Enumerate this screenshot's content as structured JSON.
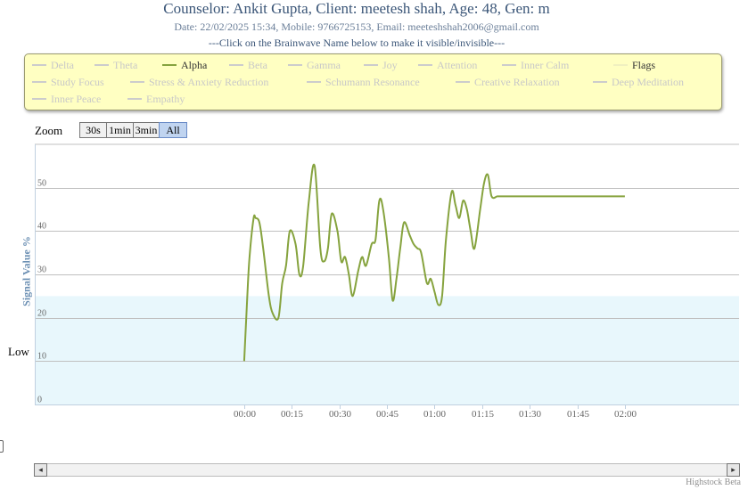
{
  "header": {
    "title": "Counselor: Ankit Gupta, Client: meetesh shah, Age: 48, Gen: m",
    "subtitle": "Date: 22/02/2025 15:34, Mobile: 9766725153, Email: meeteshshah2006@gmail.com",
    "instruction": "---Click on the Brainwave Name below to make it visible/invisible---"
  },
  "legend": {
    "items": [
      {
        "label": "Delta",
        "visible": false
      },
      {
        "label": "Theta",
        "visible": false
      },
      {
        "label": "Alpha",
        "visible": true
      },
      {
        "label": "Beta",
        "visible": false
      },
      {
        "label": "Gamma",
        "visible": false
      },
      {
        "label": "Joy",
        "visible": false
      },
      {
        "label": "Attention",
        "visible": false
      },
      {
        "label": "Inner Calm",
        "visible": false
      },
      {
        "label": "Flags",
        "visible": true
      },
      {
        "label": "Study Focus",
        "visible": false
      },
      {
        "label": "Stress & Anxiety Reduction",
        "visible": false
      },
      {
        "label": "Schumann Resonance",
        "visible": false
      },
      {
        "label": "Creative Relaxation",
        "visible": false
      },
      {
        "label": "Deep Meditation",
        "visible": false
      },
      {
        "label": "Inner Peace",
        "visible": false
      },
      {
        "label": "Empathy",
        "visible": false
      }
    ]
  },
  "zoom": {
    "label": "Zoom",
    "buttons": [
      "30s",
      "1min",
      "3min",
      "All"
    ],
    "selected": "All"
  },
  "colors": {
    "alpha_line": "#86a33e",
    "low_band": "#e8f7fc",
    "grid": "#c0c0c0",
    "legend_bg": "#ffffc2",
    "hidden_text": "#c8c8c8"
  },
  "chart_data": {
    "type": "line",
    "ylabel": "Signal Value %",
    "ylim": [
      0,
      60
    ],
    "yticks": [
      0,
      10,
      20,
      30,
      40,
      50
    ],
    "xlim": [
      -1.1,
      2.6
    ],
    "xticks": [
      0,
      0.25,
      0.5,
      0.75,
      1.0,
      1.25,
      1.5,
      1.75,
      2.0
    ],
    "xtick_labels": [
      "00:00",
      "00:15",
      "00:30",
      "00:45",
      "01:00",
      "01:15",
      "01:30",
      "01:45",
      "02:00"
    ],
    "grid": true,
    "plot_band": {
      "from": 0,
      "to": 25,
      "label": "Low"
    },
    "series": [
      {
        "name": "Alpha",
        "x": [
          0.0,
          0.02,
          0.03,
          0.05,
          0.06,
          0.08,
          0.1,
          0.13,
          0.15,
          0.18,
          0.2,
          0.22,
          0.24,
          0.27,
          0.29,
          0.31,
          0.34,
          0.37,
          0.4,
          0.42,
          0.44,
          0.46,
          0.49,
          0.51,
          0.53,
          0.55,
          0.57,
          0.6,
          0.62,
          0.64,
          0.67,
          0.69,
          0.71,
          0.73,
          0.76,
          0.78,
          0.8,
          0.82,
          0.84,
          0.87,
          0.89,
          0.91,
          0.93,
          0.96,
          0.98,
          1.0,
          1.02,
          1.04,
          1.06,
          1.09,
          1.11,
          1.13,
          1.15,
          1.17,
          1.19,
          1.21,
          1.24,
          1.26,
          1.28,
          1.3,
          1.33,
          1.35,
          1.37,
          1.39,
          1.41,
          1.44,
          1.46,
          1.48,
          1.5,
          1.52,
          1.54,
          1.56,
          1.58,
          1.61,
          1.63,
          1.65,
          1.67,
          1.69,
          1.72,
          1.74,
          1.76,
          1.78,
          1.8,
          1.82,
          1.85,
          1.87,
          1.89,
          1.91,
          1.93,
          1.96,
          1.98,
          2.0
        ],
        "y": [
          10,
          28,
          35,
          43,
          43,
          42,
          36,
          25,
          21,
          20,
          28,
          32,
          40,
          37,
          30,
          32,
          47,
          55,
          36,
          33,
          36,
          44,
          40,
          33,
          34,
          30,
          25,
          31,
          34,
          32,
          37,
          38,
          47,
          45,
          34,
          24,
          29,
          36,
          42,
          39,
          37,
          36,
          35,
          28,
          29,
          26,
          23,
          25,
          38,
          49,
          46,
          43,
          47,
          45,
          40,
          36,
          45,
          51,
          53,
          48,
          48,
          48,
          48,
          48,
          48,
          48,
          48,
          48,
          48,
          48,
          48,
          48,
          48,
          48,
          48,
          48,
          48,
          48,
          48,
          48,
          48,
          48,
          48,
          48,
          48,
          48,
          48,
          48,
          48,
          48,
          48,
          48
        ]
      }
    ]
  },
  "scrollbar": {
    "left_arrow": "◂",
    "right_arrow": "▸"
  },
  "credits": "Highstock Beta"
}
